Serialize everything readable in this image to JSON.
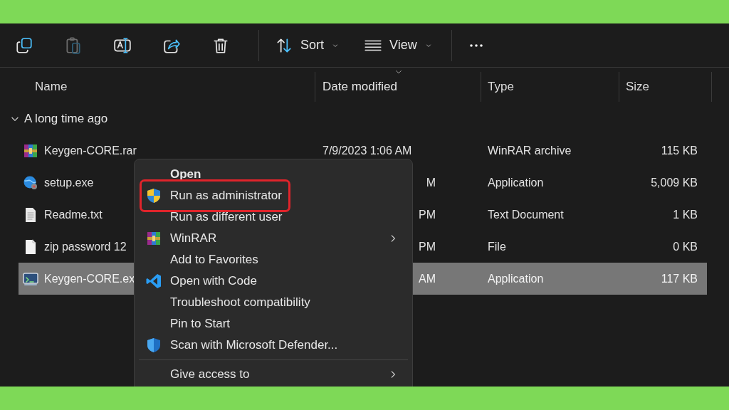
{
  "toolbar": {
    "icons": [
      {
        "kind": "copy",
        "disabled": false
      },
      {
        "kind": "paste",
        "disabled": true
      },
      {
        "kind": "rename",
        "disabled": false
      },
      {
        "kind": "share",
        "disabled": false
      },
      {
        "kind": "delete",
        "disabled": false
      }
    ],
    "buttons": [
      {
        "kind": "sort",
        "label": "Sort"
      },
      {
        "kind": "view",
        "label": "View"
      }
    ]
  },
  "table": {
    "columns": [
      {
        "label": "Name",
        "sorted": false
      },
      {
        "label": "Date modified",
        "sorted": true
      },
      {
        "label": "Type",
        "sorted": false
      },
      {
        "label": "Size",
        "sorted": false
      }
    ],
    "group": {
      "label": "A long time ago",
      "expanded": true
    },
    "rows": [
      {
        "kind": "archive",
        "name": "Keygen-CORE.rar",
        "date": "7/9/2023 1:06 AM",
        "type": "WinRAR archive",
        "size": "115 KB",
        "selected": false
      },
      {
        "kind": "installer",
        "name": "setup.exe",
        "date": "M",
        "type": "Application",
        "size": "5,009 KB",
        "selected": false
      },
      {
        "kind": "text",
        "name": "Readme.txt",
        "date": "PM",
        "type": "Text Document",
        "size": "1 KB",
        "selected": false
      },
      {
        "kind": "file",
        "name": "zip password 12",
        "date": "PM",
        "type": "File",
        "size": "0 KB",
        "selected": false
      },
      {
        "kind": "program",
        "name": "Keygen-CORE.ex",
        "date": "AM",
        "type": "Application",
        "size": "117 KB",
        "selected": true
      }
    ]
  },
  "context_menu": {
    "items": [
      {
        "kind": "plain",
        "label": "Open",
        "default": true,
        "submenu": false,
        "highlighted": false
      },
      {
        "kind": "shield",
        "label": "Run as administrator",
        "default": false,
        "submenu": false,
        "highlighted": true
      },
      {
        "kind": "plain",
        "label": "Run as different user",
        "default": false,
        "submenu": false,
        "highlighted": false
      },
      {
        "kind": "archive",
        "label": "WinRAR",
        "default": false,
        "submenu": true,
        "highlighted": false
      },
      {
        "kind": "plain",
        "label": "Add to Favorites",
        "default": false,
        "submenu": false,
        "highlighted": false
      },
      {
        "kind": "code",
        "label": "Open with Code",
        "default": false,
        "submenu": false,
        "highlighted": false
      },
      {
        "kind": "plain",
        "label": "Troubleshoot compatibility",
        "default": false,
        "submenu": false,
        "highlighted": false
      },
      {
        "kind": "plain",
        "label": "Pin to Start",
        "default": false,
        "submenu": false,
        "highlighted": false
      },
      {
        "kind": "defender",
        "label": "Scan with Microsoft Defender...",
        "default": false,
        "submenu": false,
        "highlighted": false
      },
      {
        "kind": "separator"
      },
      {
        "kind": "plain",
        "label": "Give access to",
        "default": false,
        "submenu": true,
        "highlighted": false
      }
    ]
  }
}
